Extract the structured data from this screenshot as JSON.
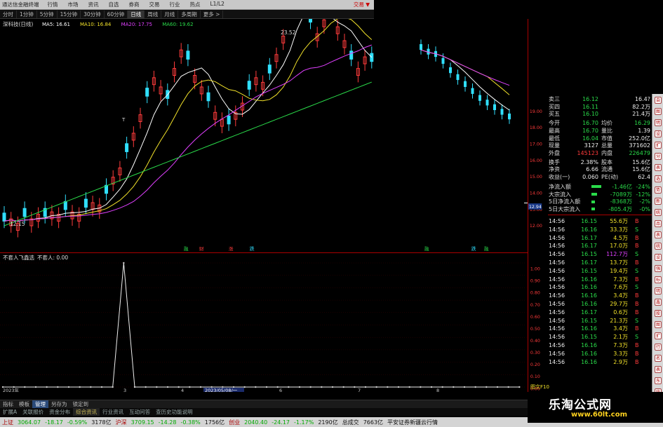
{
  "window": {
    "app_title": "通达信金融终端",
    "menu": [
      "行情",
      "市场",
      "资讯",
      "自选",
      "券商",
      "交易",
      "行业",
      "热点",
      "L1/L2"
    ],
    "trade_label": "交易 ▼"
  },
  "toolbar": {
    "items": [
      "分时",
      "1分钟",
      "5分钟",
      "15分钟",
      "30分钟",
      "60分钟",
      "日线",
      "周线",
      "月线",
      "多周期",
      "更多 >"
    ],
    "active_index": 6
  },
  "kline": {
    "title": "深科技(日线)",
    "ma": [
      {
        "label": "MA5: 16.61",
        "color": "#ffffff"
      },
      {
        "label": "MA10: 16.84",
        "color": "#f2e22a"
      },
      {
        "label": "MA20: 17.75",
        "color": "#e040ff"
      },
      {
        "label": "MA60: 19.62",
        "color": "#2adb4a"
      }
    ],
    "high_label": "23.52",
    "low_label": "12.15",
    "price_box": "12.94",
    "t_marker": "T",
    "event_marks": [
      "融",
      "财",
      "涨",
      "跌",
      "融",
      "跌",
      "融"
    ],
    "scale": [
      "19.00",
      "18.00",
      "17.00",
      "16.00",
      "15.00",
      "14.00",
      "13.00",
      "12.00"
    ]
  },
  "indicator": {
    "title": "不套人飞鑫选",
    "value_label": "不套人: 0.00",
    "scale": [
      "1.00",
      "0.90",
      "0.80",
      "0.70",
      "0.60",
      "0.50",
      "0.40",
      "0.30",
      "0.20",
      "0.10",
      "0.00"
    ],
    "axis": [
      "2023年",
      "3",
      "4",
      "2023/05/08/一",
      "6",
      "7",
      "8"
    ],
    "series_values": [
      0,
      0,
      0,
      0,
      0,
      0,
      0,
      0,
      0,
      0,
      0,
      1,
      0,
      0,
      0,
      0,
      0,
      0,
      0,
      0,
      0,
      0,
      0,
      0,
      0,
      0,
      0,
      0,
      0,
      0,
      0,
      0,
      0,
      0,
      0,
      0,
      0,
      0,
      0,
      0,
      0,
      0,
      0,
      0,
      0,
      0,
      0,
      0
    ]
  },
  "quote_panel": {
    "rows": [
      {
        "label": "卖三",
        "value": "16.12",
        "value_color": "green",
        "extra": "16.4?",
        "extra_color": "white"
      },
      {
        "label": "买四",
        "value": "16.11",
        "value_color": "green",
        "extra": "82.2万",
        "extra_color": "white"
      },
      {
        "label": "买五",
        "value": "16.10",
        "value_color": "green",
        "extra": "21.4万",
        "extra_color": "white"
      },
      {
        "label": "今开",
        "value": "16.70",
        "value_color": "green",
        "label2": "均价",
        "extra": "16.29",
        "extra_color": "green"
      },
      {
        "label": "最高",
        "value": "16.70",
        "value_color": "green",
        "label2": "量比",
        "extra": "1.39",
        "extra_color": "white"
      },
      {
        "label": "最低",
        "value": "16.04",
        "value_color": "green",
        "label2": "市值",
        "extra": "252.0亿",
        "extra_color": "white"
      },
      {
        "label": "现量",
        "value": "3127",
        "value_color": "white",
        "label2": "总量",
        "extra": "371602",
        "extra_color": "white"
      },
      {
        "label": "外盘",
        "value": "145123",
        "value_color": "red",
        "label2": "内盘",
        "extra": "226479",
        "extra_color": "green"
      },
      {
        "label": "换手",
        "value": "2.38%",
        "value_color": "white",
        "label2": "股本",
        "extra": "15.6亿",
        "extra_color": "white"
      },
      {
        "label": "净资",
        "value": "6.66",
        "value_color": "white",
        "label2": "流通",
        "extra": "15.6亿",
        "extra_color": "white"
      },
      {
        "label": "收益(一)",
        "value": "0.060",
        "value_color": "white",
        "label2": "PE(动)",
        "extra": "62.4",
        "extra_color": "white"
      }
    ],
    "flows": [
      {
        "label": "净流入额",
        "value": "-1.46亿",
        "pct": "-24%"
      },
      {
        "label": "大宗流入",
        "value": "-7089万",
        "pct": "-12%"
      },
      {
        "label": "5日净流入额",
        "value": "-8368万",
        "pct": "-2%"
      },
      {
        "label": "5日大宗流入",
        "value": "-805.4万",
        "pct": "-0%"
      }
    ],
    "ticks": [
      {
        "t": "14:56",
        "p": "16.15",
        "v": "55.6万",
        "s": "B"
      },
      {
        "t": "14:56",
        "p": "16.16",
        "v": "33.3万",
        "s": "S"
      },
      {
        "t": "14:56",
        "p": "16.17",
        "v": "4.5万",
        "s": "B"
      },
      {
        "t": "14:56",
        "p": "16.17",
        "v": "17.0万",
        "s": "B"
      },
      {
        "t": "14:56",
        "p": "16.15",
        "v": "112.7万",
        "s": "S"
      },
      {
        "t": "14:56",
        "p": "16.17",
        "v": "13.7万",
        "s": "B"
      },
      {
        "t": "14:56",
        "p": "16.15",
        "v": "19.4万",
        "s": "S"
      },
      {
        "t": "14:56",
        "p": "16.16",
        "v": "7.3万",
        "s": "B"
      },
      {
        "t": "14:56",
        "p": "16.16",
        "v": "7.6万",
        "s": "S"
      },
      {
        "t": "14:56",
        "p": "16.16",
        "v": "3.4万",
        "s": "B"
      },
      {
        "t": "14:56",
        "p": "16.16",
        "v": "29.7万",
        "s": "B"
      },
      {
        "t": "14:56",
        "p": "16.17",
        "v": "0.6万",
        "s": "B"
      },
      {
        "t": "14:56",
        "p": "16.15",
        "v": "21.3万",
        "s": "S"
      },
      {
        "t": "14:56",
        "p": "16.16",
        "v": "3.4万",
        "s": "B"
      },
      {
        "t": "14:56",
        "p": "16.15",
        "v": "2.1万",
        "s": "S"
      },
      {
        "t": "14:56",
        "p": "16.16",
        "v": "7.3万",
        "s": "B"
      },
      {
        "t": "14:56",
        "p": "16.16",
        "v": "3.3万",
        "s": "B"
      },
      {
        "t": "14:56",
        "p": "16.16",
        "v": "2.9万",
        "s": "B"
      }
    ]
  },
  "bottom_tabs": [
    "指标",
    "模板",
    "管理",
    "另存为",
    "锁定到"
  ],
  "bottom_tabs_active": 2,
  "func_bar": [
    "扩展A",
    "关联报价",
    "资金分布",
    "综合资讯",
    "行业资讯",
    "互动问答",
    "查历史功能说明"
  ],
  "status": {
    "sh_label": "上证",
    "sh": "3064.07",
    "sh_chg": "-18.17",
    "sh_pct": "-0.59%",
    "sh_amt": "3178亿",
    "sz_label": "沪深",
    "sz": "3709.15",
    "sz_chg": "-14.28",
    "sz_pct": "-0.38%",
    "sz_amt": "1756亿",
    "cy_label": "创业",
    "cy": "2040.40",
    "cy_chg": "-24.17",
    "cy_pct": "-1.17%",
    "cy_amt": "2190亿",
    "total_label": "总成交",
    "total": "7663亿",
    "broker": "平安证券新疆云行情",
    "f10": "图文F10"
  },
  "watermark": {
    "title": "乐淘公式网",
    "url": "www.60lt.com"
  },
  "side_icons": [
    "自",
    "图",
    "明",
    "设",
    "扩",
    "分",
    "表",
    "选",
    "势",
    "新",
    "统",
    "品",
    "表",
    "统",
    "设",
    "强",
    "标",
    "明",
    "鑫",
    "股",
    "图",
    "扩",
    "行",
    "名",
    "表",
    "东",
    "统",
    "弱"
  ]
}
